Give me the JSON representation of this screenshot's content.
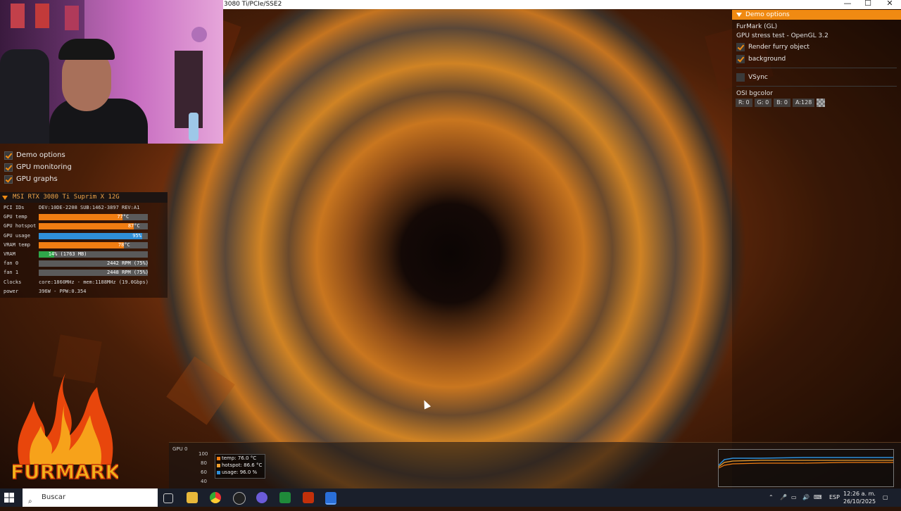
{
  "window": {
    "title": "3080 Ti/PCIe/SSE2",
    "controls": {
      "minimize": "—",
      "maximize": "☐",
      "close": "✕"
    }
  },
  "left_menu": {
    "items": [
      {
        "label": "Demo options",
        "checked": true
      },
      {
        "label": "GPU monitoring",
        "checked": true
      },
      {
        "label": "GPU graphs",
        "checked": true
      }
    ]
  },
  "gpu_panel": {
    "title": "MSI RTX 3080 Ti Suprim X 12G",
    "rows": [
      {
        "label": "PCI IDs",
        "text": "DEV:10DE-2208 SUB:1462-3897 REV:A1"
      },
      {
        "label": "GPU temp",
        "value": "77°C",
        "level": 0.77,
        "color": "#f07d12"
      },
      {
        "label": "GPU hotspot",
        "value": "87°C",
        "level": 0.87,
        "color": "#f07d12"
      },
      {
        "label": "GPU usage",
        "value": "95%",
        "level": 0.95,
        "color": "#2f8fd8"
      },
      {
        "label": "VRAM temp",
        "value": "78°C",
        "level": 0.78,
        "color": "#f07d12"
      },
      {
        "label": "VRAM",
        "value": "14% (1763 MB)",
        "level": 0.14,
        "color": "#2fa84a"
      },
      {
        "label": "fan 0",
        "value": "2442 RPM (75%)",
        "level": 0.0,
        "color": "#5a5a5a"
      },
      {
        "label": "fan 1",
        "value": "2448 RPM (75%)",
        "level": 0.0,
        "color": "#5a5a5a"
      },
      {
        "label": "Clocks",
        "text": "core:1860MHz - mem:1188MHz (19.0Gbps)"
      },
      {
        "label": "power",
        "text": "396W - PPW:0.354"
      }
    ]
  },
  "demo_options": {
    "header": "Demo options",
    "app_name": "FurMark (GL)",
    "subtitle": "GPU stress test - OpenGL 3.2",
    "render_furry_label": "Render furry object",
    "background_label": "background",
    "vsync_label": "VSync",
    "osi_label": "OSI bgcolor",
    "r_label": "R: 0",
    "g_label": "G: 0",
    "b_label": "B: 0",
    "a_label": "A:128"
  },
  "graphs": {
    "gpu_label": "GPU 0",
    "ticks": [
      "100",
      "80",
      "60",
      "40"
    ],
    "legend": [
      {
        "label": "temp: 76.0 °C",
        "color": "#f07d12"
      },
      {
        "label": "hotspot: 86.6 °C",
        "color": "#f0a030"
      },
      {
        "label": "usage: 96.0 %",
        "color": "#2f8fd8"
      }
    ]
  },
  "logo_text": "FURMARK",
  "taskbar": {
    "search_placeholder": "Buscar",
    "language": "ESP",
    "time": "12:26 a. m.",
    "date": "26/10/2025"
  }
}
